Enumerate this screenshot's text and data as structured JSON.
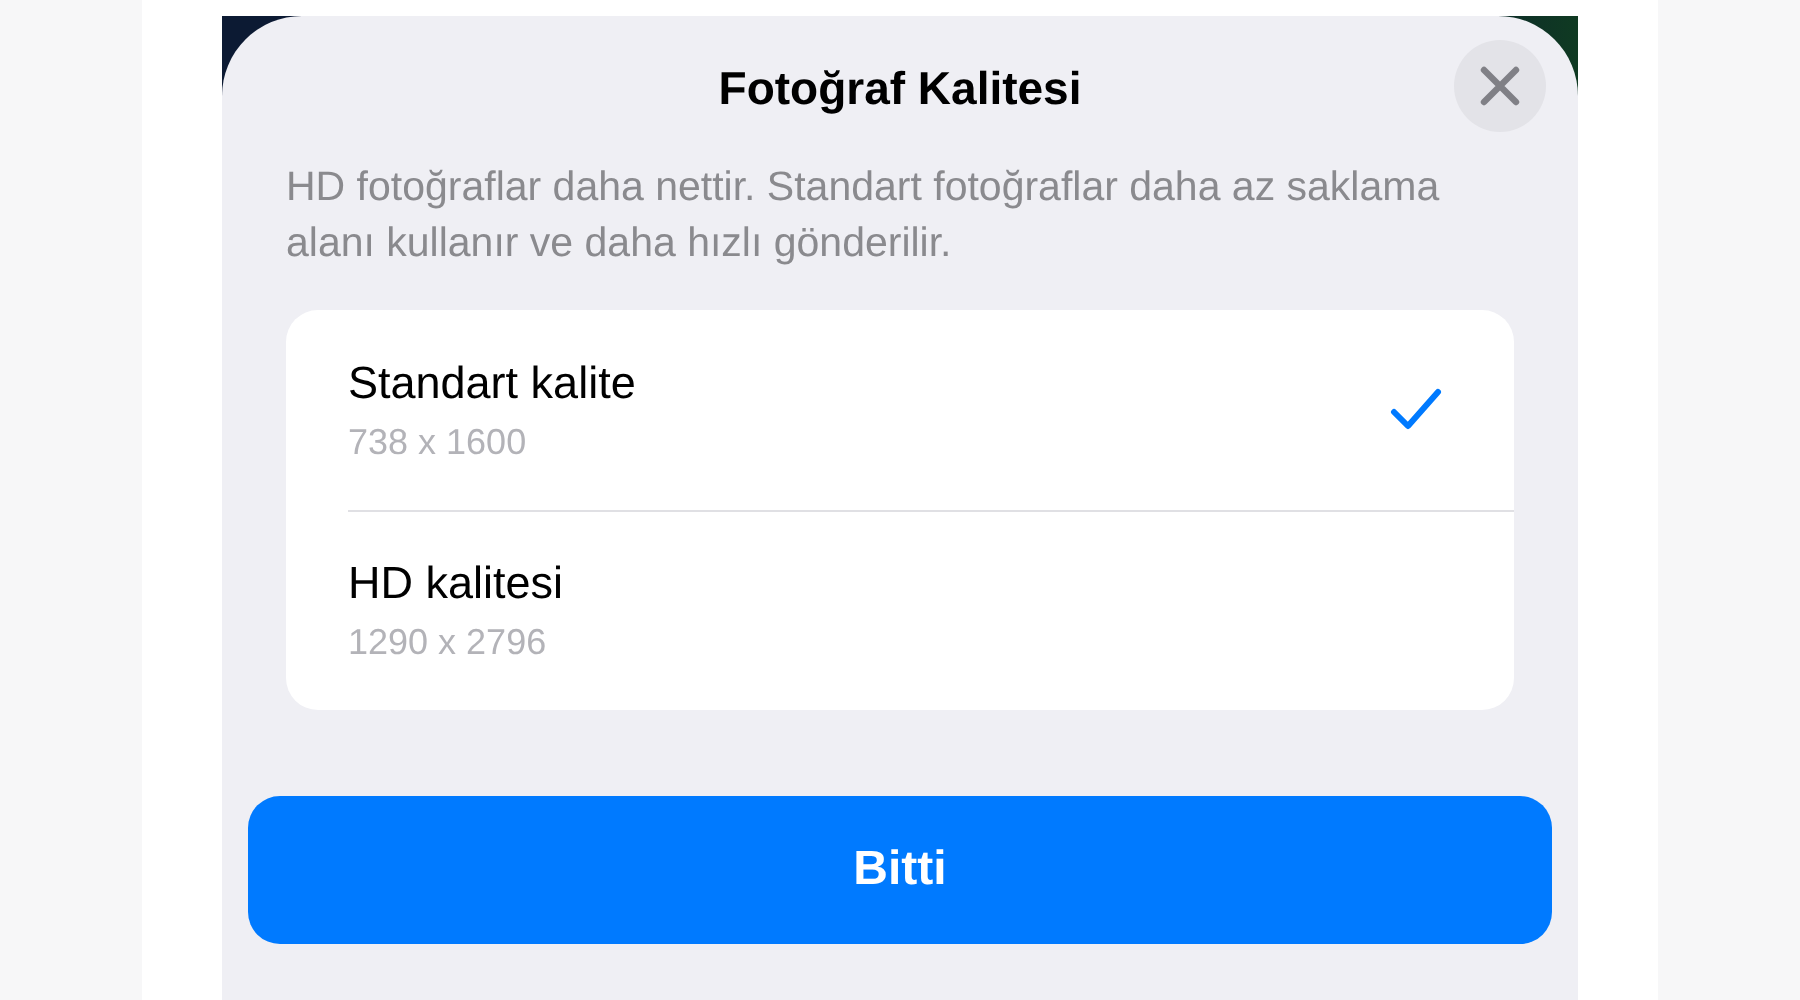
{
  "sheet": {
    "title": "Fotoğraf Kalitesi",
    "description": "HD fotoğraflar daha nettir. Standart fotoğraflar daha az saklama alanı kullanır ve daha hızlı gönderilir."
  },
  "options": [
    {
      "label": "Standart kalite",
      "resolution": "738 x 1600",
      "selected": true
    },
    {
      "label": "HD kalitesi",
      "resolution": "1290 x 2796",
      "selected": false
    }
  ],
  "button": {
    "label": "Bitti"
  }
}
